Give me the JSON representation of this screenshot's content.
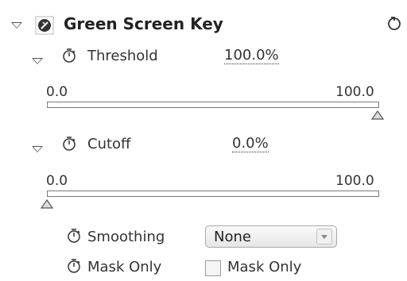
{
  "effect": {
    "title": "Green Screen Key"
  },
  "threshold": {
    "label": "Threshold",
    "value": "100.0%",
    "range_min": "0.0",
    "range_max": "100.0",
    "fraction": 1.0
  },
  "cutoff": {
    "label": "Cutoff",
    "value": "0.0%",
    "range_min": "0.0",
    "range_max": "100.0",
    "fraction": 0.0
  },
  "smoothing": {
    "label": "Smoothing",
    "selected": "None"
  },
  "mask_only": {
    "label": "Mask Only",
    "checkbox_label": "Mask Only",
    "checked": false
  },
  "icons": [
    "twirl-triangle-icon",
    "fx-badge-icon",
    "stopwatch-icon",
    "reset-icon",
    "slider-handle-icon",
    "dropdown-arrow-icon"
  ]
}
